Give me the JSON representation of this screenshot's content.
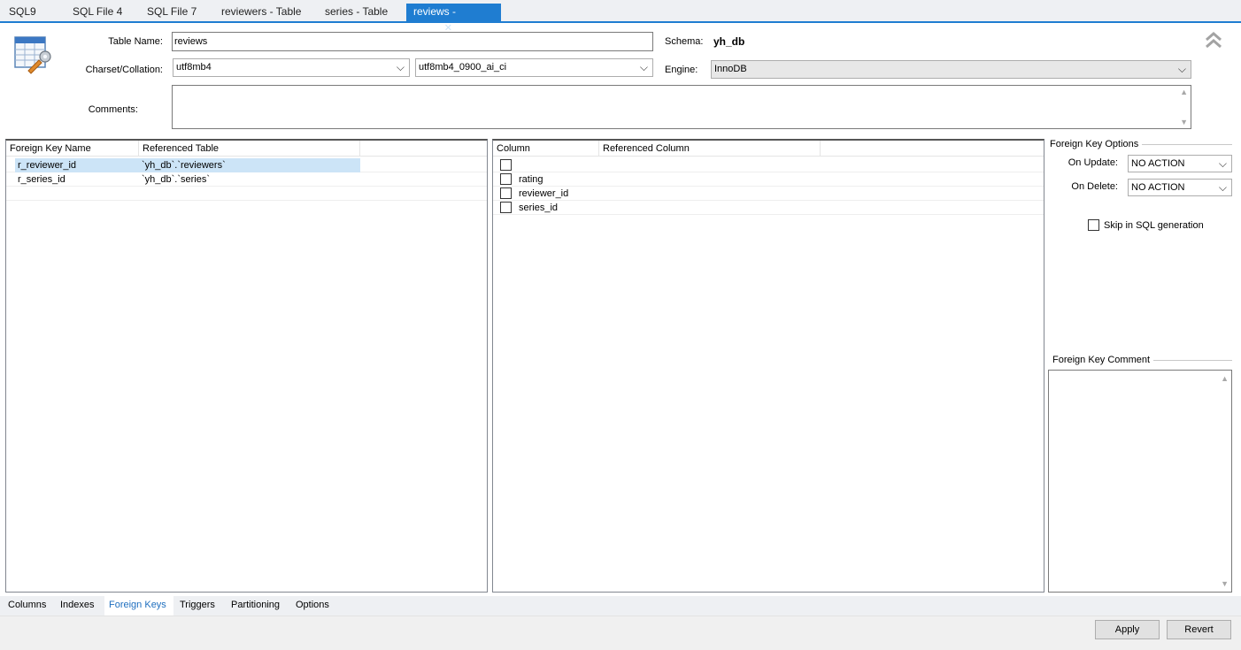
{
  "tabs": [
    {
      "label": "SQL9"
    },
    {
      "label": "SQL File 4"
    },
    {
      "label": "SQL File 7"
    },
    {
      "label": "reviewers - Table"
    },
    {
      "label": "series - Table"
    },
    {
      "label": "reviews - Table",
      "active": true
    }
  ],
  "form": {
    "table_name_label": "Table Name:",
    "table_name_value": "reviews",
    "schema_label": "Schema:",
    "schema_value": "yh_db",
    "charset_label": "Charset/Collation:",
    "charset_value": "utf8mb4",
    "collation_value": "utf8mb4_0900_ai_ci",
    "engine_label": "Engine:",
    "engine_value": "InnoDB",
    "comments_label": "Comments:",
    "comments_value": ""
  },
  "fk_grid": {
    "headers": [
      "Foreign Key Name",
      "Referenced Table"
    ],
    "rows": [
      {
        "name": "r_reviewer_id",
        "table": "`yh_db`.`reviewers`",
        "selected": true
      },
      {
        "name": "r_series_id",
        "table": "`yh_db`.`series`"
      }
    ]
  },
  "col_grid": {
    "headers": [
      "Column",
      "Referenced Column"
    ],
    "rows": [
      {
        "column": "",
        "ref": "",
        "checked": false
      },
      {
        "column": "rating",
        "ref": "",
        "checked": false
      },
      {
        "column": "reviewer_id",
        "ref": "",
        "checked": false
      },
      {
        "column": "series_id",
        "ref": "",
        "checked": false
      }
    ]
  },
  "fk_options": {
    "title": "Foreign Key Options",
    "on_update_label": "On Update:",
    "on_update_value": "NO ACTION",
    "on_delete_label": "On Delete:",
    "on_delete_value": "NO ACTION",
    "skip_label": "Skip in SQL generation",
    "skip_checked": false,
    "comment_title": "Foreign Key Comment"
  },
  "bottom_tabs": [
    {
      "label": "Columns"
    },
    {
      "label": "Indexes"
    },
    {
      "label": "Foreign Keys",
      "active": true
    },
    {
      "label": "Triggers"
    },
    {
      "label": "Partitioning"
    },
    {
      "label": "Options"
    }
  ],
  "buttons": {
    "apply": "Apply",
    "revert": "Revert"
  },
  "colors": {
    "accent": "#1f7dd1",
    "selection": "#cce4f7",
    "active_subtab_text": "#1f6fbf"
  },
  "icons": {
    "table_editor": "table-wrench-icon",
    "collapse": "double-chevron-up-icon",
    "dropdown": "chevron-down-icon",
    "tab_close": "close-icon"
  }
}
